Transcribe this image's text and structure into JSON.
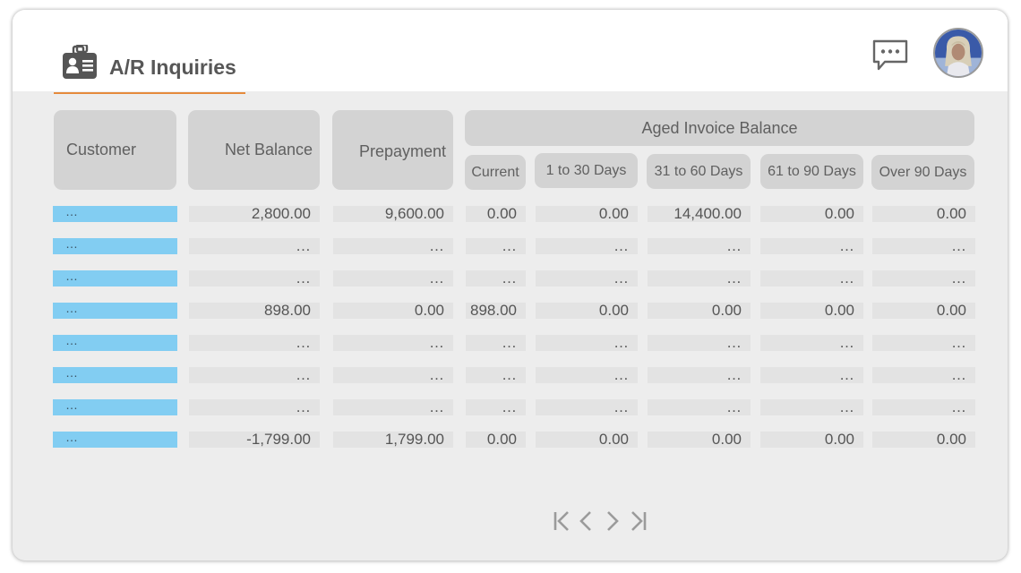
{
  "header": {
    "title": "A/R Inquiries",
    "icon": "contact-card-icon",
    "accent_color": "#e58a3c"
  },
  "actions": {
    "chat_icon": "chat-bubble-icon",
    "avatar": "user-avatar"
  },
  "table": {
    "columns": {
      "customer": "Customer",
      "net_balance": "Net Balance",
      "prepayment": "Prepayment",
      "aged_group": "Aged Invoice Balance",
      "current": "Current",
      "d1_30": "1 to 30 Days",
      "d31_60": "31 to 60 Days",
      "d61_90": "61 to 90 Days",
      "over90": "Over 90 Days"
    },
    "rows": [
      {
        "customer": "…",
        "net": "2,800.00",
        "prepay": "9,600.00",
        "current": "0.00",
        "d1_30": "0.00",
        "d31_60": "14,400.00",
        "d61_90": "0.00",
        "over90": "0.00"
      },
      {
        "customer": "…",
        "net": "…",
        "prepay": "…",
        "current": "…",
        "d1_30": "…",
        "d31_60": "…",
        "d61_90": "…",
        "over90": "…"
      },
      {
        "customer": "…",
        "net": "…",
        "prepay": "…",
        "current": "…",
        "d1_30": "…",
        "d31_60": "…",
        "d61_90": "…",
        "over90": "…"
      },
      {
        "customer": "…",
        "net": "898.00",
        "prepay": "0.00",
        "current": "898.00",
        "d1_30": "0.00",
        "d31_60": "0.00",
        "d61_90": "0.00",
        "over90": "0.00"
      },
      {
        "customer": "…",
        "net": "…",
        "prepay": "…",
        "current": "…",
        "d1_30": "…",
        "d31_60": "…",
        "d61_90": "…",
        "over90": "…"
      },
      {
        "customer": "…",
        "net": "…",
        "prepay": "…",
        "current": "…",
        "d1_30": "…",
        "d31_60": "…",
        "d61_90": "…",
        "over90": "…"
      },
      {
        "customer": "…",
        "net": "…",
        "prepay": "…",
        "current": "…",
        "d1_30": "…",
        "d31_60": "…",
        "d61_90": "…",
        "over90": "…"
      },
      {
        "customer": "…",
        "net": "-1,799.00",
        "prepay": "1,799.00",
        "current": "0.00",
        "d1_30": "0.00",
        "d31_60": "0.00",
        "d61_90": "0.00",
        "over90": "0.00"
      }
    ],
    "customer_color": "#82cdf2"
  },
  "pagination": {
    "first_icon": "first-page-icon",
    "prev_icon": "previous-page-icon",
    "next_icon": "next-page-icon",
    "last_icon": "last-page-icon"
  }
}
